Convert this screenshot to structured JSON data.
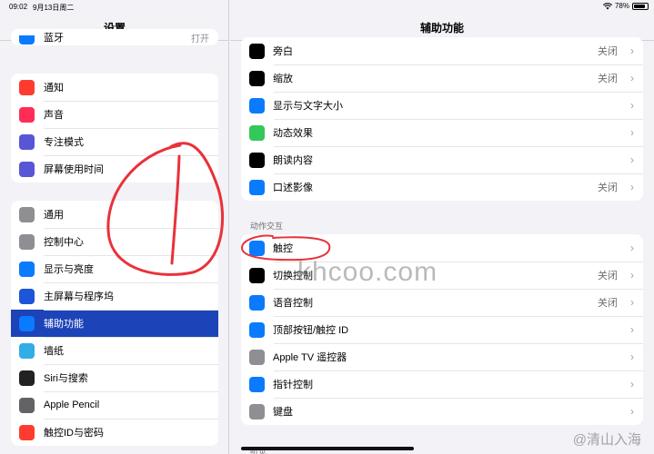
{
  "status": {
    "time": "09:02",
    "date": "9月13日周二",
    "battery_level": 0.78,
    "battery_text": "78%"
  },
  "sidebar": {
    "title": "设置",
    "partial_row": {
      "label": "蓝牙",
      "value": "打开"
    },
    "group1": [
      {
        "label": "通知",
        "icon": "bell-icon",
        "color": "#ff3b30"
      },
      {
        "label": "声音",
        "icon": "speaker-icon",
        "color": "#ff2d55"
      },
      {
        "label": "专注模式",
        "icon": "moon-icon",
        "color": "#5856d6"
      },
      {
        "label": "屏幕使用时间",
        "icon": "hourglass-icon",
        "color": "#5856d6"
      }
    ],
    "group2": [
      {
        "label": "通用",
        "icon": "gear-icon",
        "color": "#8e8e93"
      },
      {
        "label": "控制中心",
        "icon": "toggles-icon",
        "color": "#8e8e93"
      },
      {
        "label": "显示与亮度",
        "icon": "aa-icon",
        "color": "#0a7aff"
      },
      {
        "label": "主屏幕与程序坞",
        "icon": "grid-icon",
        "color": "#1c55d8"
      },
      {
        "label": "辅助功能",
        "icon": "accessibility-icon",
        "color": "#0a7aff"
      },
      {
        "label": "墙纸",
        "icon": "flower-icon",
        "color": "#32ade6"
      },
      {
        "label": "Siri与搜索",
        "icon": "siri-icon",
        "color": "#222222"
      },
      {
        "label": "Apple Pencil",
        "icon": "pencil-icon",
        "color": "#636366"
      },
      {
        "label": "触控ID与密码",
        "icon": "fingerprint-icon",
        "color": "#ff3b30"
      }
    ],
    "selected_index": 4
  },
  "main": {
    "title": "辅助功能",
    "vision": [
      {
        "label": "旁白",
        "value": "关闭",
        "icon": "voiceover-icon",
        "color": "#000000"
      },
      {
        "label": "缩放",
        "value": "关闭",
        "icon": "zoom-icon",
        "color": "#000000"
      },
      {
        "label": "显示与文字大小",
        "value": "",
        "icon": "aa-icon",
        "color": "#0a7aff"
      },
      {
        "label": "动态效果",
        "value": "",
        "icon": "motion-icon",
        "color": "#34c759"
      },
      {
        "label": "朗读内容",
        "value": "",
        "icon": "speech-icon",
        "color": "#000000"
      },
      {
        "label": "口述影像",
        "value": "关闭",
        "icon": "audio-description-icon",
        "color": "#0a7aff"
      }
    ],
    "section_label": "动作交互",
    "interaction": [
      {
        "label": "触控",
        "value": "",
        "icon": "hand-icon",
        "color": "#0a7aff"
      },
      {
        "label": "切换控制",
        "value": "关闭",
        "icon": "switch-control-icon",
        "color": "#000000"
      },
      {
        "label": "语音控制",
        "value": "关闭",
        "icon": "voice-control-icon",
        "color": "#0a7aff"
      },
      {
        "label": "顶部按钮/触控 ID",
        "value": "",
        "icon": "top-button-icon",
        "color": "#0a7aff"
      },
      {
        "label": "Apple TV 遥控器",
        "value": "",
        "icon": "remote-icon",
        "color": "#8e8e93"
      },
      {
        "label": "指针控制",
        "value": "",
        "icon": "pointer-icon",
        "color": "#0a7aff"
      },
      {
        "label": "键盘",
        "value": "",
        "icon": "keyboard-icon",
        "color": "#8e8e93"
      }
    ],
    "bottom_section_label": "听觉"
  },
  "chevron": "›",
  "watermark": "khcoo.com",
  "corner_watermark": "@清山入海"
}
